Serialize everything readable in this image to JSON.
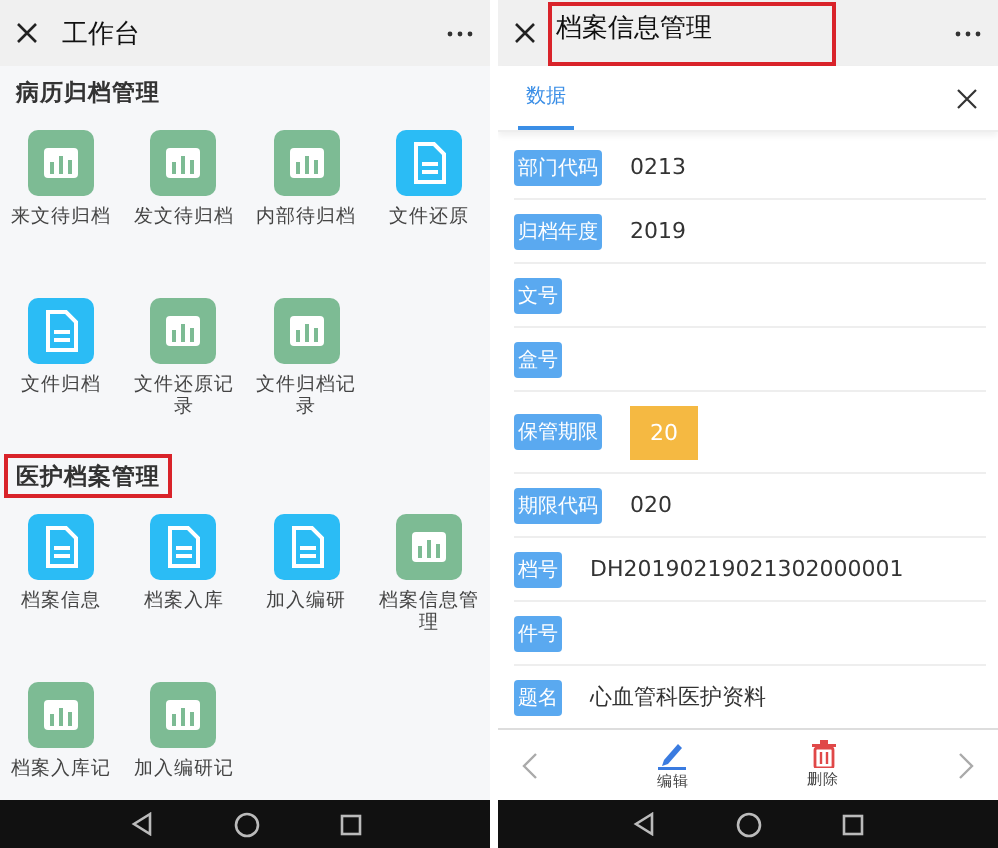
{
  "left": {
    "header": {
      "title": "工作台"
    },
    "sections": [
      {
        "title": "病历归档管理",
        "highlighted": false,
        "items": [
          {
            "label": "来文待归档",
            "kind": "chart"
          },
          {
            "label": "发文待归档",
            "kind": "chart"
          },
          {
            "label": "内部待归档",
            "kind": "chart"
          },
          {
            "label": "文件还原",
            "kind": "doc"
          },
          {
            "label": "文件归档",
            "kind": "doc"
          },
          {
            "label": "文件还原记录",
            "kind": "chart"
          },
          {
            "label": "文件归档记录",
            "kind": "chart"
          }
        ]
      },
      {
        "title": "医护档案管理",
        "highlighted": true,
        "items": [
          {
            "label": "档案信息",
            "kind": "doc"
          },
          {
            "label": "档案入库",
            "kind": "doc"
          },
          {
            "label": "加入编研",
            "kind": "doc"
          },
          {
            "label": "档案信息管理",
            "kind": "chart"
          },
          {
            "label": "档案入库记",
            "kind": "chart"
          },
          {
            "label": "加入编研记",
            "kind": "chart"
          }
        ]
      }
    ]
  },
  "right": {
    "header": {
      "title": "档案信息管理",
      "highlighted": true
    },
    "tabs": [
      {
        "label": "数据",
        "selected": true
      }
    ],
    "fields": [
      {
        "label": "部门代码",
        "value": "0213",
        "kind": "text"
      },
      {
        "label": "归档年度",
        "value": "2019",
        "kind": "text"
      },
      {
        "label": "文号",
        "kind": "text"
      },
      {
        "label": "盒号",
        "kind": "text"
      },
      {
        "label": "保管期限",
        "value": "20",
        "kind": "badge"
      },
      {
        "label": "期限代码",
        "value": "020",
        "kind": "text"
      },
      {
        "label": "档号",
        "value": "DH20190219021302000001",
        "kind": "text"
      },
      {
        "label": "件号",
        "kind": "text"
      },
      {
        "label": "题名",
        "value": "心血管科医护资料",
        "kind": "text"
      }
    ],
    "toolbar": [
      {
        "label": "编辑",
        "kind": "edit"
      },
      {
        "label": "删除",
        "kind": "delete"
      }
    ]
  }
}
